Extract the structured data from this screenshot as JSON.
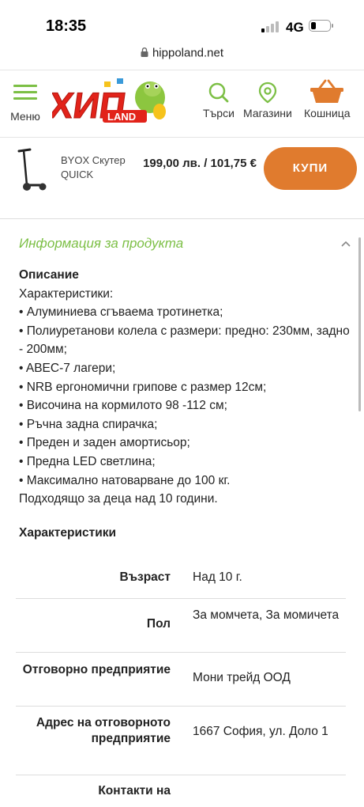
{
  "status": {
    "time": "18:35",
    "network": "4G"
  },
  "browser": {
    "url": "hippoland.net"
  },
  "header": {
    "menu_label": "Меню",
    "search_label": "Търси",
    "stores_label": "Магазини",
    "cart_label": "Кошница",
    "brand_color": "#7cbf45",
    "accent_color": "#e07b2e"
  },
  "product": {
    "name": "BYOX Скутер QUICK",
    "price": "199,00 лв. / 101,75 €",
    "buy_label": "КУПИ"
  },
  "info": {
    "title": "Информация за продукта",
    "description_heading": "Описание",
    "lines": [
      "Характеристики:",
      "• Алуминиева сгъваема тротинетка;",
      "• Полиуретанови колела с размери: предно: 230мм, задно - 200мм;",
      "• ABEC-7 лагери;",
      "• NRB ергономични грипове с размер 12см;",
      "• Височина на кормилото 98 -112 см;",
      "• Ръчна задна спирачка;",
      "• Преден и заден амортисьор;",
      "• Предна LED светлина;",
      "• Максимално натоварване до 100 кг.",
      "Подходящо за деца над 10 години."
    ],
    "characteristics_title": "Характеристики",
    "characteristics": [
      {
        "key": "Възраст",
        "value": "Над 10 г."
      },
      {
        "key": "Пол",
        "value": "За момчета, За момичета"
      },
      {
        "key": "Отговорно предприятие",
        "value": "Мони трейд ООД"
      },
      {
        "key": "Адрес на отговорното предприятие",
        "value": "1667 София, ул. Доло 1"
      },
      {
        "key": "Контакти на",
        "value": ""
      }
    ]
  }
}
